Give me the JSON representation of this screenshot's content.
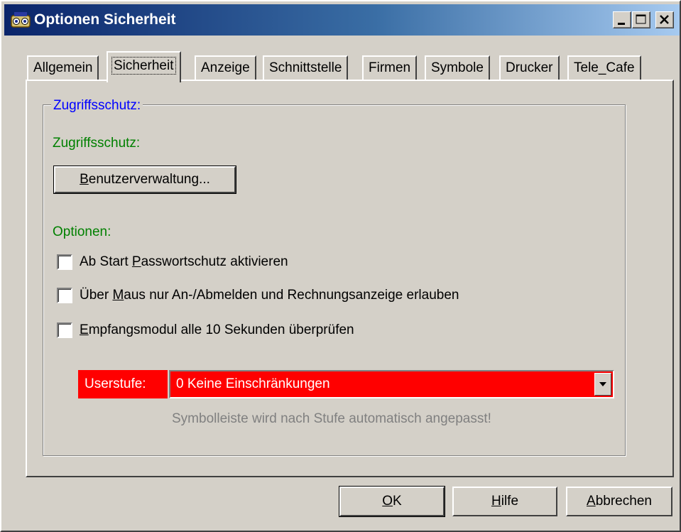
{
  "window": {
    "title": "Optionen Sicherheit",
    "accent_color": "#0a246a",
    "icon": "app-icon"
  },
  "tabs": [
    {
      "label": "Allgemein",
      "active": false
    },
    {
      "label": "Sicherheit",
      "active": true
    },
    {
      "label": "Anzeige",
      "active": false
    },
    {
      "label": "Schnittstelle",
      "active": false
    },
    {
      "label": "Firmen",
      "active": false
    },
    {
      "label": "Symbole",
      "active": false
    },
    {
      "label": "Drucker",
      "active": false
    },
    {
      "label": "Tele_Cafe",
      "active": false
    }
  ],
  "group": {
    "title": "Zugriffsschutz:",
    "access_label": "Zugriffsschutz:",
    "user_admin_button": {
      "pre": "",
      "mnemonic": "B",
      "post": "enutzerverwaltung..."
    },
    "options_label": "Optionen:",
    "checkboxes": [
      {
        "pre": "Ab Start ",
        "mnemonic": "P",
        "post": "asswortschutz aktivieren",
        "checked": false
      },
      {
        "pre": "Über ",
        "mnemonic": "M",
        "post": "aus nur An-/Abmelden und Rechnungsanzeige erlauben",
        "checked": false
      },
      {
        "pre": "",
        "mnemonic": "E",
        "post": "mpfangsmodul alle 10 Sekunden überprüfen",
        "checked": false
      }
    ],
    "userstufe_label": "Userstufe:",
    "userstufe_value": "0  Keine Einschränkungen",
    "hint": "Symbolleiste wird nach Stufe automatisch angepasst!",
    "highlight_color": "#ff0000"
  },
  "buttons": {
    "ok": {
      "pre": "",
      "mnemonic": "O",
      "post": "K"
    },
    "help": {
      "pre": "",
      "mnemonic": "H",
      "post": "ilfe"
    },
    "cancel": {
      "pre": "",
      "mnemonic": "A",
      "post": "bbrechen"
    }
  }
}
